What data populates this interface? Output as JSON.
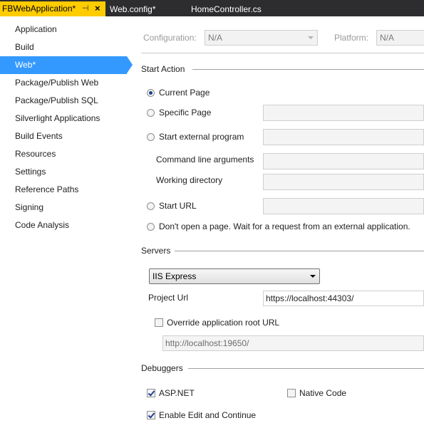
{
  "tabs": {
    "active": "FBWebApplication*",
    "active_pin": "⊣",
    "active_close": "×",
    "second": "Web.config*",
    "third": "HomeController.cs"
  },
  "sidebar": {
    "items": [
      {
        "label": "Application"
      },
      {
        "label": "Build"
      },
      {
        "label": "Web*",
        "selected": true
      },
      {
        "label": "Package/Publish Web"
      },
      {
        "label": "Package/Publish SQL"
      },
      {
        "label": "Silverlight Applications"
      },
      {
        "label": "Build Events"
      },
      {
        "label": "Resources"
      },
      {
        "label": "Settings"
      },
      {
        "label": "Reference Paths"
      },
      {
        "label": "Signing"
      },
      {
        "label": "Code Analysis"
      }
    ]
  },
  "config": {
    "configuration_label": "Configuration:",
    "configuration_value": "N/A",
    "platform_label": "Platform:",
    "platform_value": "N/A"
  },
  "start_action": {
    "title": "Start Action",
    "current_page": "Current Page",
    "specific_page": "Specific Page",
    "external_program": "Start external program",
    "command_line": "Command line arguments",
    "working_dir": "Working directory",
    "start_url": "Start URL",
    "dont_open": "Don't open a page.  Wait for a request from an external application.",
    "selected": "current_page"
  },
  "servers": {
    "title": "Servers",
    "server_value": "IIS Express",
    "project_url_label": "Project Url",
    "project_url_value": "https://localhost:44303/",
    "override_label": "Override application root URL",
    "override_checked": false,
    "override_value": "http://localhost:19650/"
  },
  "debuggers": {
    "title": "Debuggers",
    "aspnet": "ASP.NET",
    "aspnet_checked": true,
    "native": "Native Code",
    "native_checked": false,
    "edit_continue": "Enable Edit and Continue",
    "edit_continue_checked": true
  },
  "colors": {
    "accent": "#3399ff",
    "active_tab": "#ffcc00",
    "tabstrip": "#2d2d30"
  }
}
